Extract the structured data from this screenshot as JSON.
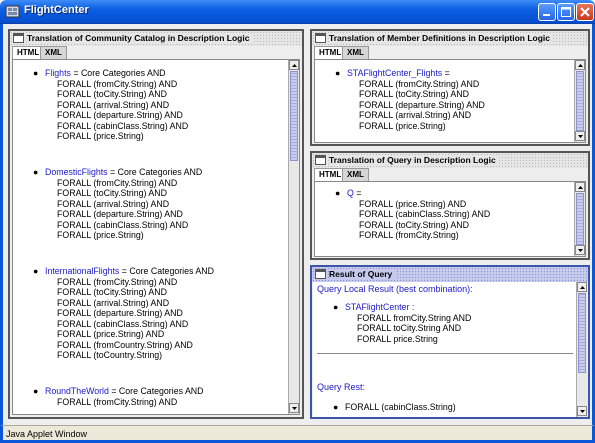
{
  "window": {
    "title": "FlightCenter",
    "status": "Java Applet Window"
  },
  "catalog_panel": {
    "title": "Translation of Community Catalog in Description Logic",
    "tabs": [
      "HTML",
      "XML"
    ],
    "definitions": [
      {
        "name": "Flights",
        "rest": " = Core Categories AND",
        "lines": [
          "FORALL  (fromCity.String)  AND",
          "FORALL  (toCity.String)  AND",
          "FORALL  (arrival.String)  AND",
          "FORALL  (departure.String)  AND",
          "FORALL  (cabinClass.String)  AND",
          "FORALL  (price.String)"
        ]
      },
      {
        "name": "DomesticFlights",
        "rest": " = Core Categories AND",
        "lines": [
          "FORALL  (fromCity.String)  AND",
          "FORALL  (toCity.String)  AND",
          "FORALL  (arrival.String)  AND",
          "FORALL  (departure.String)  AND",
          "FORALL  (cabinClass.String)  AND",
          "FORALL  (price.String)"
        ]
      },
      {
        "name": "InternationalFlights",
        "rest": " = Core Categories AND",
        "lines": [
          "FORALL  (fromCity.String)  AND",
          "FORALL  (toCity.String)  AND",
          "FORALL  (arrival.String)  AND",
          "FORALL  (departure.String)  AND",
          "FORALL  (cabinClass.String)  AND",
          "FORALL  (price.String)  AND",
          "FORALL  (fromCountry.String)  AND",
          "FORALL  (toCountry.String)"
        ]
      },
      {
        "name": "RoundTheWorld",
        "rest": " = Core Categories AND",
        "lines": [
          "FORALL  (fromCity.String)  AND"
        ]
      }
    ]
  },
  "member_panel": {
    "title": "Translation of Member Definitions in Description Logic",
    "tabs": [
      "HTML",
      "XML"
    ],
    "definition": {
      "name": "STAFlightCenter_Flights",
      "rest": " =",
      "lines": [
        "FORALL  (fromCity.String)  AND",
        "FORALL  (toCity.String)  AND",
        "FORALL  (departure.String)  AND",
        "FORALL  (arrival.String)  AND",
        "FORALL  (price.String)"
      ]
    }
  },
  "query_panel": {
    "title": "Translation of Query in Description Logic",
    "tabs": [
      "HTML",
      "XML"
    ],
    "definition": {
      "name": "Q",
      "rest": " =",
      "lines": [
        "FORALL  (price.String)  AND",
        "FORALL  (cabinClass.String)  AND",
        "FORALL  (toCity.String)  AND",
        "FORALL  (fromCity.String)"
      ]
    }
  },
  "result_panel": {
    "title": "Result of Query",
    "local_label": "Query Local Result (best combination):",
    "local_name": "STAFlightCenter  :",
    "local_lines": [
      "FORALL fromCity.String  AND",
      "FORALL toCity.String  AND",
      "FORALL price.String"
    ],
    "rest_label": "Query Rest:",
    "rest_line": "FORALL (cabinClass.String)"
  },
  "colors": {
    "titlebar": "#0a5ee0",
    "link_blue": "#1a1ac8",
    "active_header": "#c6cbee"
  }
}
